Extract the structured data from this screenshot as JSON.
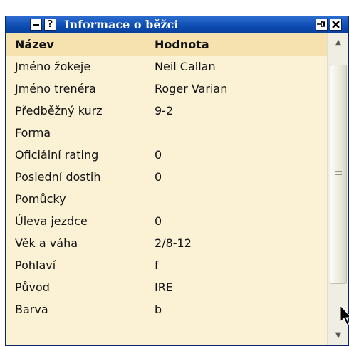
{
  "window": {
    "title": "Informace o běžci",
    "help_label": "?"
  },
  "table": {
    "headers": {
      "name": "Název",
      "value": "Hodnota"
    },
    "rows": [
      {
        "label": "Jméno žokeje",
        "value": "Neil Callan"
      },
      {
        "label": "Jméno trenéra",
        "value": "Roger Varian"
      },
      {
        "label": "Předběžný kurz",
        "value": "9-2"
      },
      {
        "label": "Forma",
        "value": ""
      },
      {
        "label": "Oficiální rating",
        "value": "0"
      },
      {
        "label": "Poslední dostih",
        "value": "0"
      },
      {
        "label": "Pomůcky",
        "value": ""
      },
      {
        "label": "Úleva jezdce",
        "value": "0"
      },
      {
        "label": "Věk a váha",
        "value": "2/8-12"
      },
      {
        "label": "Pohlaví",
        "value": "f"
      },
      {
        "label": "Původ",
        "value": "IRE"
      },
      {
        "label": "Barva",
        "value": "b"
      }
    ]
  },
  "colors": {
    "titlebar": "#0b4bb0",
    "header_row": "#f6e2ae",
    "body": "#fbf1d4"
  }
}
